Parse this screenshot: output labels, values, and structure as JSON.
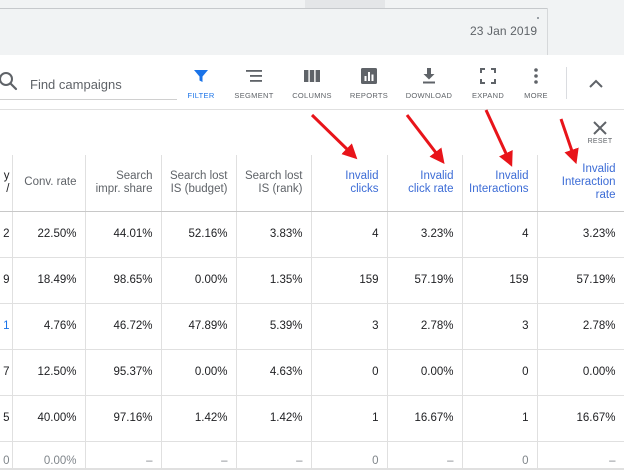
{
  "header": {
    "date": "23 Jan 2019"
  },
  "search": {
    "placeholder": "Find campaigns"
  },
  "toolbar": {
    "tools": [
      {
        "key": "filter",
        "label": "FILTER",
        "icon": "filter-icon"
      },
      {
        "key": "segment",
        "label": "SEGMENT",
        "icon": "segment-icon"
      },
      {
        "key": "columns",
        "label": "COLUMNS",
        "icon": "columns-icon"
      },
      {
        "key": "reports",
        "label": "REPORTS",
        "icon": "reports-icon"
      },
      {
        "key": "download",
        "label": "DOWNLOAD",
        "icon": "download-icon"
      },
      {
        "key": "expand",
        "label": "EXPAND",
        "icon": "expand-icon"
      },
      {
        "key": "more",
        "label": "MORE",
        "icon": "more-vert-icon"
      }
    ],
    "active_color": "#1a73e8"
  },
  "reset": {
    "label": "RESET"
  },
  "table": {
    "headers": [
      "y\n/",
      "Conv. rate",
      "Search\nimpr. share",
      "Search lost\nIS (budget)",
      "Search lost\nIS (rank)",
      "Invalid\nclicks",
      "Invalid\nclick rate",
      "Invalid\nInteractions",
      "Invalid\nInteraction\nrate"
    ],
    "rows": [
      [
        "2",
        "22.50%",
        "44.01%",
        "52.16%",
        "3.83%",
        "4",
        "3.23%",
        "4",
        "3.23%"
      ],
      [
        "9",
        "18.49%",
        "98.65%",
        "0.00%",
        "1.35%",
        "159",
        "57.19%",
        "159",
        "57.19%"
      ],
      [
        "1",
        "4.76%",
        "46.72%",
        "47.89%",
        "5.39%",
        "3",
        "2.78%",
        "3",
        "2.78%"
      ],
      [
        "7",
        "12.50%",
        "95.37%",
        "0.00%",
        "4.63%",
        "0",
        "0.00%",
        "0",
        "0.00%"
      ],
      [
        "5",
        "40.00%",
        "97.16%",
        "1.42%",
        "1.42%",
        "1",
        "16.67%",
        "1",
        "16.67%"
      ],
      [
        "0",
        "0.00%",
        "–",
        "–",
        "–",
        "0",
        "–",
        "0",
        "–"
      ]
    ]
  },
  "annotations": {
    "arrow_color": "#e8141a"
  }
}
